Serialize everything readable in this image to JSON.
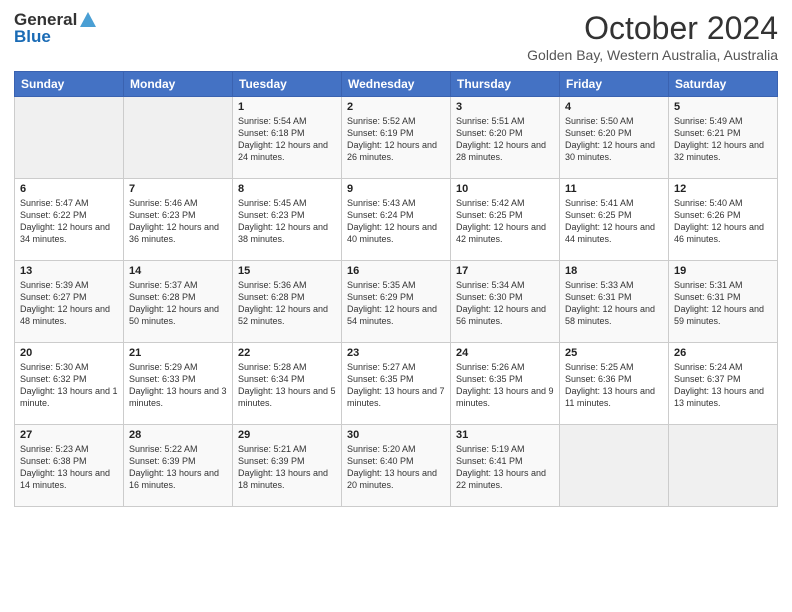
{
  "header": {
    "logo_general": "General",
    "logo_blue": "Blue",
    "month_title": "October 2024",
    "location": "Golden Bay, Western Australia, Australia"
  },
  "days_of_week": [
    "Sunday",
    "Monday",
    "Tuesday",
    "Wednesday",
    "Thursday",
    "Friday",
    "Saturday"
  ],
  "weeks": [
    [
      {
        "day": "",
        "info": ""
      },
      {
        "day": "",
        "info": ""
      },
      {
        "day": "1",
        "info": "Sunrise: 5:54 AM\nSunset: 6:18 PM\nDaylight: 12 hours and 24 minutes."
      },
      {
        "day": "2",
        "info": "Sunrise: 5:52 AM\nSunset: 6:19 PM\nDaylight: 12 hours and 26 minutes."
      },
      {
        "day": "3",
        "info": "Sunrise: 5:51 AM\nSunset: 6:20 PM\nDaylight: 12 hours and 28 minutes."
      },
      {
        "day": "4",
        "info": "Sunrise: 5:50 AM\nSunset: 6:20 PM\nDaylight: 12 hours and 30 minutes."
      },
      {
        "day": "5",
        "info": "Sunrise: 5:49 AM\nSunset: 6:21 PM\nDaylight: 12 hours and 32 minutes."
      }
    ],
    [
      {
        "day": "6",
        "info": "Sunrise: 5:47 AM\nSunset: 6:22 PM\nDaylight: 12 hours and 34 minutes."
      },
      {
        "day": "7",
        "info": "Sunrise: 5:46 AM\nSunset: 6:23 PM\nDaylight: 12 hours and 36 minutes."
      },
      {
        "day": "8",
        "info": "Sunrise: 5:45 AM\nSunset: 6:23 PM\nDaylight: 12 hours and 38 minutes."
      },
      {
        "day": "9",
        "info": "Sunrise: 5:43 AM\nSunset: 6:24 PM\nDaylight: 12 hours and 40 minutes."
      },
      {
        "day": "10",
        "info": "Sunrise: 5:42 AM\nSunset: 6:25 PM\nDaylight: 12 hours and 42 minutes."
      },
      {
        "day": "11",
        "info": "Sunrise: 5:41 AM\nSunset: 6:25 PM\nDaylight: 12 hours and 44 minutes."
      },
      {
        "day": "12",
        "info": "Sunrise: 5:40 AM\nSunset: 6:26 PM\nDaylight: 12 hours and 46 minutes."
      }
    ],
    [
      {
        "day": "13",
        "info": "Sunrise: 5:39 AM\nSunset: 6:27 PM\nDaylight: 12 hours and 48 minutes."
      },
      {
        "day": "14",
        "info": "Sunrise: 5:37 AM\nSunset: 6:28 PM\nDaylight: 12 hours and 50 minutes."
      },
      {
        "day": "15",
        "info": "Sunrise: 5:36 AM\nSunset: 6:28 PM\nDaylight: 12 hours and 52 minutes."
      },
      {
        "day": "16",
        "info": "Sunrise: 5:35 AM\nSunset: 6:29 PM\nDaylight: 12 hours and 54 minutes."
      },
      {
        "day": "17",
        "info": "Sunrise: 5:34 AM\nSunset: 6:30 PM\nDaylight: 12 hours and 56 minutes."
      },
      {
        "day": "18",
        "info": "Sunrise: 5:33 AM\nSunset: 6:31 PM\nDaylight: 12 hours and 58 minutes."
      },
      {
        "day": "19",
        "info": "Sunrise: 5:31 AM\nSunset: 6:31 PM\nDaylight: 12 hours and 59 minutes."
      }
    ],
    [
      {
        "day": "20",
        "info": "Sunrise: 5:30 AM\nSunset: 6:32 PM\nDaylight: 13 hours and 1 minute."
      },
      {
        "day": "21",
        "info": "Sunrise: 5:29 AM\nSunset: 6:33 PM\nDaylight: 13 hours and 3 minutes."
      },
      {
        "day": "22",
        "info": "Sunrise: 5:28 AM\nSunset: 6:34 PM\nDaylight: 13 hours and 5 minutes."
      },
      {
        "day": "23",
        "info": "Sunrise: 5:27 AM\nSunset: 6:35 PM\nDaylight: 13 hours and 7 minutes."
      },
      {
        "day": "24",
        "info": "Sunrise: 5:26 AM\nSunset: 6:35 PM\nDaylight: 13 hours and 9 minutes."
      },
      {
        "day": "25",
        "info": "Sunrise: 5:25 AM\nSunset: 6:36 PM\nDaylight: 13 hours and 11 minutes."
      },
      {
        "day": "26",
        "info": "Sunrise: 5:24 AM\nSunset: 6:37 PM\nDaylight: 13 hours and 13 minutes."
      }
    ],
    [
      {
        "day": "27",
        "info": "Sunrise: 5:23 AM\nSunset: 6:38 PM\nDaylight: 13 hours and 14 minutes."
      },
      {
        "day": "28",
        "info": "Sunrise: 5:22 AM\nSunset: 6:39 PM\nDaylight: 13 hours and 16 minutes."
      },
      {
        "day": "29",
        "info": "Sunrise: 5:21 AM\nSunset: 6:39 PM\nDaylight: 13 hours and 18 minutes."
      },
      {
        "day": "30",
        "info": "Sunrise: 5:20 AM\nSunset: 6:40 PM\nDaylight: 13 hours and 20 minutes."
      },
      {
        "day": "31",
        "info": "Sunrise: 5:19 AM\nSunset: 6:41 PM\nDaylight: 13 hours and 22 minutes."
      },
      {
        "day": "",
        "info": ""
      },
      {
        "day": "",
        "info": ""
      }
    ]
  ]
}
